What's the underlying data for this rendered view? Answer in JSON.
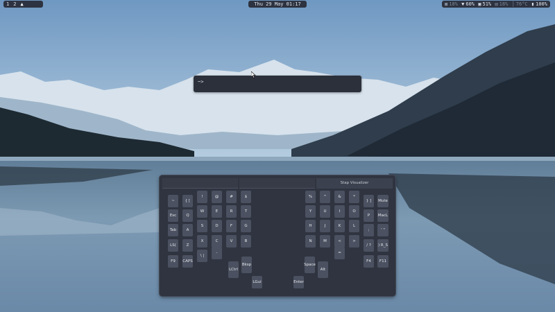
{
  "topbar": {
    "workspaces": [
      "1",
      "2"
    ],
    "clock": "Thu 29 May 01:17",
    "status": {
      "item1_value": "18%",
      "wifi_value": "60%",
      "cpu_value": "51%",
      "ram_value": "18%",
      "temp_value": "76°C",
      "battery_value": "100%"
    }
  },
  "launcher": {
    "prompt": "~>"
  },
  "keyboard_window": {
    "tabs": [
      "",
      "",
      "Stap Visualizer"
    ],
    "left_half": [
      [
        "~",
        "{ [",
        "!",
        "@",
        "#",
        "$"
      ],
      [
        "Esc",
        "Q",
        "W",
        "E",
        "R",
        "T"
      ],
      [
        "Tab",
        "A",
        "S",
        "D",
        "F",
        "G"
      ],
      [
        "LS(",
        "Z",
        "X",
        "C",
        "V",
        "B"
      ],
      [
        "F9",
        "CAPS",
        "\\ |",
        "-"
      ]
    ],
    "left_thumb": [
      "LCtrl",
      "Bksp",
      "LGui"
    ],
    "right_half": [
      [
        "%",
        "^",
        "&",
        "*",
        "} ]",
        "Mute"
      ],
      [
        "Y",
        "U",
        "I",
        "O",
        "P",
        "MacL"
      ],
      [
        "H",
        "J",
        "K",
        "L",
        ";",
        "' \""
      ],
      [
        "N",
        "M",
        "<",
        ">",
        "/ ?",
        ") R_S"
      ],
      [
        "=",
        "F4",
        "F11"
      ]
    ],
    "right_thumb": [
      "Space",
      "Alt",
      "Enter"
    ]
  }
}
